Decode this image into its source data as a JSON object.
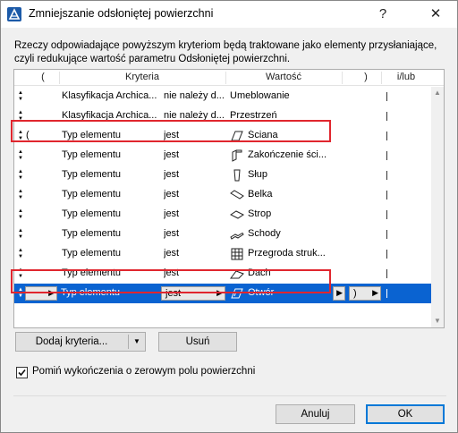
{
  "window": {
    "title": "Zmniejszanie odsłoniętej powierzchni",
    "help_label": "?",
    "close_label": "✕"
  },
  "description": {
    "line1": "Rzeczy odpowiadające powyższym kryteriom będą traktowane jako elementy przysłaniające,",
    "line2": "czyli redukujące wartość parametru Odsłoniętej powierzchni."
  },
  "table": {
    "headers": {
      "open_paren": "(",
      "criteria": "Kryteria",
      "value": "Wartość",
      "close_paren": ")",
      "and_or": "i/lub"
    },
    "rows": [
      {
        "paren_open": "",
        "criterion": "Klasyfikacja Archica...",
        "operator": "nie należy d...",
        "value": "Umeblowanie",
        "icon": "",
        "paren_close": "",
        "selected": false
      },
      {
        "paren_open": "",
        "criterion": "Klasyfikacja Archica...",
        "operator": "nie należy d...",
        "value": "Przestrzeń",
        "icon": "",
        "paren_close": "",
        "selected": false
      },
      {
        "paren_open": "(",
        "criterion": "Typ elementu",
        "operator": "jest",
        "value": "Ściana",
        "icon": "wall-icon",
        "paren_close": "",
        "selected": false
      },
      {
        "paren_open": "",
        "criterion": "Typ elementu",
        "operator": "jest",
        "value": "Zakończenie ści...",
        "icon": "wall-end-icon",
        "paren_close": "",
        "selected": false
      },
      {
        "paren_open": "",
        "criterion": "Typ elementu",
        "operator": "jest",
        "value": "Słup",
        "icon": "column-icon",
        "paren_close": "",
        "selected": false
      },
      {
        "paren_open": "",
        "criterion": "Typ elementu",
        "operator": "jest",
        "value": "Belka",
        "icon": "beam-icon",
        "paren_close": "",
        "selected": false
      },
      {
        "paren_open": "",
        "criterion": "Typ elementu",
        "operator": "jest",
        "value": "Strop",
        "icon": "slab-icon",
        "paren_close": "",
        "selected": false
      },
      {
        "paren_open": "",
        "criterion": "Typ elementu",
        "operator": "jest",
        "value": "Schody",
        "icon": "stair-icon",
        "paren_close": "",
        "selected": false
      },
      {
        "paren_open": "",
        "criterion": "Typ elementu",
        "operator": "jest",
        "value": "Przegroda struk...",
        "icon": "curtain-wall-icon",
        "paren_close": "",
        "selected": false
      },
      {
        "paren_open": "",
        "criterion": "Typ elementu",
        "operator": "jest",
        "value": "Dach",
        "icon": "roof-icon",
        "paren_close": "",
        "selected": false
      },
      {
        "paren_open": "",
        "criterion": "Typ elementu",
        "operator": "jest",
        "value": "Otwór",
        "icon": "opening-icon",
        "paren_close": ")",
        "selected": true
      }
    ]
  },
  "buttons": {
    "add_criteria": "Dodaj kryteria...",
    "add_criteria_arrow": "▼",
    "remove": "Usuń",
    "cancel": "Anuluj",
    "ok": "OK"
  },
  "checkbox": {
    "label": "Pomiń wykończenia o zerowym polu powierzchni",
    "checked": true
  },
  "colors": {
    "selection": "#0a63d1",
    "highlight_frame": "#e0262e"
  }
}
